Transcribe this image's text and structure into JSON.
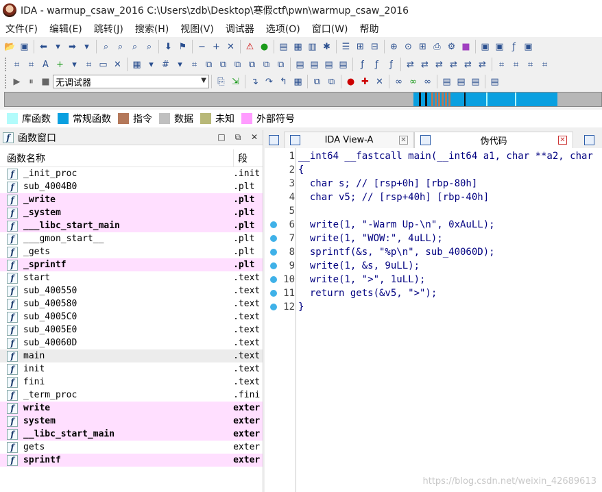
{
  "window": {
    "title": "IDA - warmup_csaw_2016 C:\\Users\\zdb\\Desktop\\寒假ctf\\pwn\\warmup_csaw_2016"
  },
  "menu": [
    "文件(F)",
    "编辑(E)",
    "跳转(J)",
    "搜索(H)",
    "视图(V)",
    "调试器",
    "选项(O)",
    "窗口(W)",
    "帮助"
  ],
  "debugger_select": {
    "value": "无调试器"
  },
  "legend": [
    {
      "label": "库函数",
      "color": "#b2fbfb"
    },
    {
      "label": "常规函数",
      "color": "#0aa0e0"
    },
    {
      "label": "指令",
      "color": "#b4785a"
    },
    {
      "label": "数据",
      "color": "#c0c0c0"
    },
    {
      "label": "未知",
      "color": "#b8b878"
    },
    {
      "label": "外部符号",
      "color": "#ff9cff"
    }
  ],
  "functions_panel": {
    "title": "函数窗口",
    "col_name": "函数名称",
    "col_segment": "段",
    "rows": [
      {
        "name": "_init_proc",
        "segment": ".init",
        "kind": "normal"
      },
      {
        "name": "sub_4004B0",
        "segment": ".plt",
        "kind": "normal"
      },
      {
        "name": "_write",
        "segment": ".plt",
        "kind": "import"
      },
      {
        "name": "_system",
        "segment": ".plt",
        "kind": "import"
      },
      {
        "name": "___libc_start_main",
        "segment": ".plt",
        "kind": "import"
      },
      {
        "name": "___gmon_start__",
        "segment": ".plt",
        "kind": "normal"
      },
      {
        "name": "_gets",
        "segment": ".plt",
        "kind": "import-light"
      },
      {
        "name": "_sprintf",
        "segment": ".plt",
        "kind": "import"
      },
      {
        "name": "start",
        "segment": ".text",
        "kind": "normal"
      },
      {
        "name": "sub_400550",
        "segment": ".text",
        "kind": "normal"
      },
      {
        "name": "sub_400580",
        "segment": ".text",
        "kind": "normal"
      },
      {
        "name": "sub_4005C0",
        "segment": ".text",
        "kind": "normal"
      },
      {
        "name": "sub_4005E0",
        "segment": ".text",
        "kind": "normal"
      },
      {
        "name": "sub_40060D",
        "segment": ".text",
        "kind": "normal"
      },
      {
        "name": "main",
        "segment": ".text",
        "kind": "selected"
      },
      {
        "name": "init",
        "segment": ".text",
        "kind": "normal"
      },
      {
        "name": "fini",
        "segment": ".text",
        "kind": "normal"
      },
      {
        "name": "_term_proc",
        "segment": ".fini",
        "kind": "normal"
      },
      {
        "name": "write",
        "segment": "exter",
        "kind": "import"
      },
      {
        "name": "system",
        "segment": "exter",
        "kind": "import"
      },
      {
        "name": "__libc_start_main",
        "segment": "exter",
        "kind": "import"
      },
      {
        "name": "gets",
        "segment": "exter",
        "kind": "import-light"
      },
      {
        "name": "sprintf",
        "segment": "exter",
        "kind": "import"
      }
    ]
  },
  "tabs": [
    {
      "label": "IDA View-A",
      "active": false
    },
    {
      "label": "伪代码",
      "active": true
    }
  ],
  "pseudocode": [
    {
      "num": "1",
      "text": "__int64 __fastcall main(__int64 a1, char **a2, char",
      "dot": false
    },
    {
      "num": "2",
      "text": "{",
      "dot": false
    },
    {
      "num": "3",
      "text": "  char s; // [rsp+0h] [rbp-80h]",
      "dot": false
    },
    {
      "num": "4",
      "text": "  char v5; // [rsp+40h] [rbp-40h]",
      "dot": false
    },
    {
      "num": "5",
      "text": "",
      "dot": false
    },
    {
      "num": "6",
      "text": "  write(1, \"-Warm Up-\\n\", 0xAuLL);",
      "dot": true
    },
    {
      "num": "7",
      "text": "  write(1, \"WOW:\", 4uLL);",
      "dot": true
    },
    {
      "num": "8",
      "text": "  sprintf(&s, \"%p\\n\", sub_40060D);",
      "dot": true
    },
    {
      "num": "9",
      "text": "  write(1, &s, 9uLL);",
      "dot": true
    },
    {
      "num": "10",
      "text": "  write(1, \">\", 1uLL);",
      "dot": true
    },
    {
      "num": "11",
      "text": "  return gets(&v5, \">\");",
      "dot": true
    },
    {
      "num": "12",
      "text": "}",
      "dot": true
    }
  ],
  "watermark": "https://blog.csdn.net/weixin_42689613"
}
